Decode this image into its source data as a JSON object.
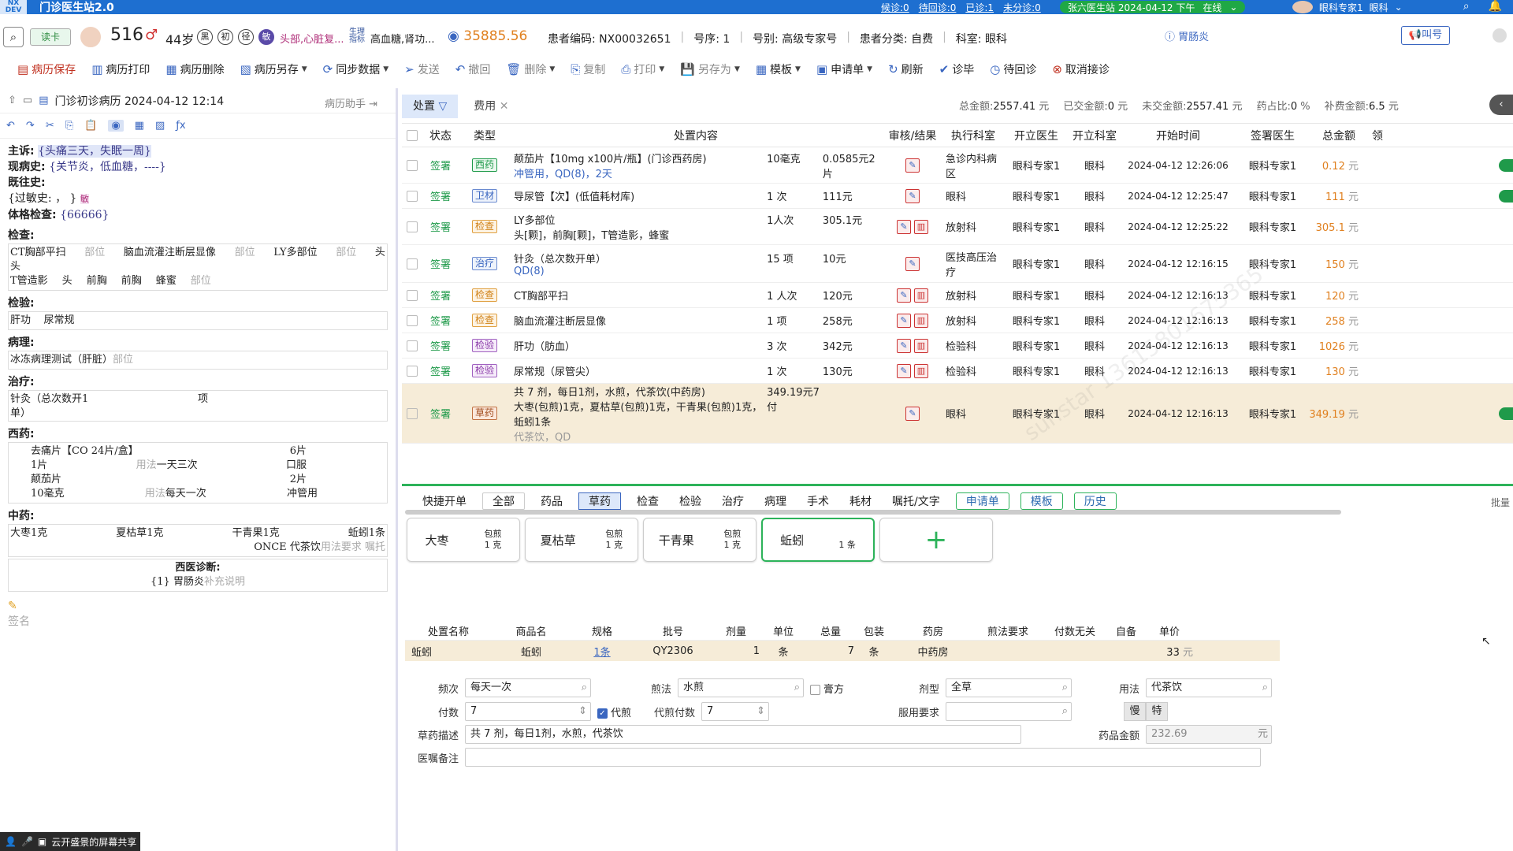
{
  "titlebar": {
    "logo": "NX DEV",
    "title": "门诊医生站2.0",
    "links": [
      "候诊:0",
      "待回诊:0",
      "已诊:1",
      "未分诊:0"
    ],
    "station": "张六医生站 2024-04-12 下午",
    "status": "在线",
    "user": "眼科专家1",
    "dept": "眼科"
  },
  "patient": {
    "read_btn": "读卡",
    "number": "516",
    "sex": "♂",
    "age": "44岁",
    "circles": [
      "黑",
      "初",
      "径",
      "敏"
    ],
    "allergy": "头部,心脏复...",
    "biomarker": "生理指标",
    "diagnosis_text": "高血糖,肾功...",
    "balance": "35885.56",
    "code_label": "患者编码:",
    "code": "NX00032651",
    "seq_label": "号序:",
    "seq": "1",
    "reg_label": "号别:",
    "reg": "高级专家号",
    "cat_label": "患者分类:",
    "cat": "自费",
    "dept_label": "科室:",
    "dept": "眼科",
    "diag_badge": "胃肠炎",
    "call_btn": "叫号"
  },
  "toolbar": [
    "病历保存",
    "病历打印",
    "病历删除",
    "病历另存",
    "同步数据",
    "发送",
    "撤回",
    "删除",
    "复制",
    "打印",
    "另存为",
    "模板",
    "申请单",
    "刷新",
    "诊毕",
    "待回诊",
    "取消接诊"
  ],
  "left": {
    "doc_title": "门诊初诊病历 2024-04-12 12:14",
    "assist": "病历助手",
    "cc_label": "主诉:",
    "cc": "{头痛三天，失眠一周}",
    "hpi_label": "现病史:",
    "hpi": "{关节炎，低血糖，----}",
    "ph_label": "既往史:",
    "allergy_label": "{过敏史:",
    "allergy_val": "， }",
    "pe_label": "体格检查:",
    "pe": "{66666}",
    "exam_label": "检查:",
    "exam_items": [
      "CT胸部平扫",
      "部位",
      "脑血流灌注断层显像",
      "部位",
      "LY多部位",
      "部位",
      "头"
    ],
    "exam_line2": [
      "头",
      "T管造影",
      "头",
      "前胸",
      "前胸",
      "蜂蜜",
      "部位"
    ],
    "lab_label": "检验:",
    "lab_items": [
      "肝功",
      "尿常规"
    ],
    "path_label": "病理:",
    "path": "冰冻病理测试（肝脏）",
    "path_part": "部位",
    "treat_label": "治疗:",
    "treat": "针灸（总次数开1",
    "treat_unit": "项",
    "treat_unit2": "单）",
    "wm_label": "西药:",
    "wm": [
      {
        "name": "去痛片【CO 24片/盒】",
        "qty": "6片"
      },
      {
        "name": "1片",
        "usage": "用法",
        "freq": "一天三次",
        "route": "口服"
      },
      {
        "name": "颠茄片",
        "qty": "2片"
      },
      {
        "name": "10毫克",
        "usage": "用法",
        "freq": "每天一次",
        "route": "冲管用"
      }
    ],
    "cm_label": "中药:",
    "cm_items": [
      "大枣1克",
      "夏枯草1克",
      "干青果1克",
      "蚯蚓1条"
    ],
    "cm_once": "ONCE",
    "cm_method": "代茶饮",
    "cm_req": "用法要求",
    "cm_note": "嘱托",
    "wd_label": "西医诊断:",
    "wd": "{1} 胃肠炎",
    "wd_hint": "补充说明",
    "sign": "签名"
  },
  "main": {
    "tab_active": "处置",
    "tab2": "费用",
    "summary": [
      {
        "label": "总金额:",
        "value": "2557.41",
        "unit": "元"
      },
      {
        "label": "已交金额:",
        "value": "0",
        "unit": "元"
      },
      {
        "label": "未交金额:",
        "value": "2557.41",
        "unit": "元"
      },
      {
        "label": "药占比:",
        "value": "0",
        "unit": "%"
      },
      {
        "label": "补费金额:",
        "value": "6.5",
        "unit": "元"
      }
    ],
    "headers": [
      "状态",
      "类型",
      "处置内容",
      "审核/结果",
      "执行科室",
      "开立医生",
      "开立科室",
      "开始时间",
      "签署医生",
      "总金额",
      "领"
    ],
    "rows": [
      {
        "status": "签署",
        "type": "西药",
        "tcls": "tb-xy",
        "name": "颠茄片【10mg x100片/瓶】(门诊西药房)",
        "sub": "冲管用，QD(8)，2天",
        "qty": "10毫克",
        "price": "0.0585元2片",
        "audit": 1,
        "exec": "急诊内科病区",
        "doc": "眼科专家1",
        "dept": "眼科",
        "time": "2024-04-12 12:26:06",
        "signer": "眼科专家1",
        "amount": "0.12",
        "tail": "台"
      },
      {
        "status": "签署",
        "type": "卫材",
        "tcls": "tb-wc",
        "name": "导尿管【次】(低值耗材库)",
        "sub": "",
        "qty": "1 次",
        "price": "111元",
        "audit": 1,
        "exec": "眼科",
        "doc": "眼科专家1",
        "dept": "眼科",
        "time": "2024-04-12 12:25:47",
        "signer": "眼科专家1",
        "amount": "111",
        "tail": "台"
      },
      {
        "status": "签署",
        "type": "检查",
        "tcls": "tb-jc",
        "name": "LY多部位",
        "sub": "头[颗]，前胸[颗]，T管造影，蜂蜜",
        "qty": "1人次",
        "price": "305.1元",
        "audit": 2,
        "exec": "放射科",
        "doc": "眼科专家1",
        "dept": "眼科",
        "time": "2024-04-12 12:25:22",
        "signer": "眼科专家1",
        "amount": "305.1",
        "tail": ""
      },
      {
        "status": "签署",
        "type": "治疗",
        "tcls": "tb-zl",
        "name": "针灸（总次数开单）",
        "sub": "QD(8)",
        "qty": "15 项",
        "price": "10元",
        "audit": 1,
        "exec": "医技高压治疗",
        "doc": "眼科专家1",
        "dept": "眼科",
        "time": "2024-04-12 12:16:15",
        "signer": "眼科专家1",
        "amount": "150",
        "tail": ""
      },
      {
        "status": "签署",
        "type": "检查",
        "tcls": "tb-jc",
        "name": "CT胸部平扫",
        "sub": "",
        "qty": "1 人次",
        "price": "120元",
        "audit": 2,
        "exec": "放射科",
        "doc": "眼科专家1",
        "dept": "眼科",
        "time": "2024-04-12 12:16:13",
        "signer": "眼科专家1",
        "amount": "120",
        "tail": ""
      },
      {
        "status": "签署",
        "type": "检查",
        "tcls": "tb-jc",
        "name": "脑血流灌注断层显像",
        "sub": "",
        "qty": "1 项",
        "price": "258元",
        "audit": 2,
        "exec": "放射科",
        "doc": "眼科专家1",
        "dept": "眼科",
        "time": "2024-04-12 12:16:13",
        "signer": "眼科专家1",
        "amount": "258",
        "tail": ""
      },
      {
        "status": "签署",
        "type": "检验",
        "tcls": "tb-jy",
        "name": "肝功（肪血）",
        "sub": "",
        "qty": "3 次",
        "price": "342元",
        "audit": 2,
        "exec": "检验科",
        "doc": "眼科专家1",
        "dept": "眼科",
        "time": "2024-04-12 12:16:13",
        "signer": "眼科专家1",
        "amount": "1026",
        "tail": ""
      },
      {
        "status": "签署",
        "type": "检验",
        "tcls": "tb-jy",
        "name": "尿常规（尿管尖）",
        "sub": "",
        "qty": "1 次",
        "price": "130元",
        "audit": 2,
        "exec": "检验科",
        "doc": "眼科专家1",
        "dept": "眼科",
        "time": "2024-04-12 12:16:13",
        "signer": "眼科专家1",
        "amount": "130",
        "tail": ""
      },
      {
        "status": "签署",
        "type": "草药",
        "tcls": "tb-cy",
        "name": "共 7 剂，每日1剂，水煎，代茶饮(中药房)",
        "sub": "大枣(包煎)1克，夏枯草(包煎)1克，干青果(包煎)1克，蚯蚓1条",
        "sub2": "代茶饮，QD",
        "qty": "349.19元7付",
        "price": "",
        "audit": 1,
        "exec": "眼科",
        "doc": "眼科专家1",
        "dept": "眼科",
        "time": "2024-04-12 12:16:13",
        "signer": "眼科专家1",
        "amount": "349.19",
        "tail": "台"
      }
    ]
  },
  "bottom": {
    "tabs": [
      "快捷开单",
      "全部",
      "药品",
      "草药",
      "检查",
      "检验",
      "治疗",
      "病理",
      "手术",
      "耗材",
      "嘱托/文字"
    ],
    "green_tabs": [
      "申请单",
      "模板",
      "历史"
    ],
    "batch": "批量",
    "herbs": [
      {
        "name": "大枣",
        "prep": "包煎",
        "dose": "1 克"
      },
      {
        "name": "夏枯草",
        "prep": "包煎",
        "dose": "1 克"
      },
      {
        "name": "干青果",
        "prep": "包煎",
        "dose": "1 克"
      },
      {
        "name": "蚯蚓",
        "prep": "",
        "dose": "1 条"
      }
    ],
    "dheaders": [
      "处置名称",
      "商品名",
      "规格",
      "批号",
      "剂量",
      "单位",
      "总量",
      "包装",
      "药房",
      "煎法要求",
      "付数无关",
      "自备",
      "单价"
    ],
    "drow": {
      "name": "蚯蚓",
      "product": "蚯蚓",
      "spec": "1条",
      "batch": "QY2306",
      "dose": "1",
      "unit": "条",
      "total": "7",
      "pack": "条",
      "pharmacy": "中药房",
      "price": "33"
    },
    "form": {
      "freq_label": "频次",
      "freq": "每天一次",
      "decoct_label": "煎法",
      "decoct": "水煎",
      "paste_label": "膏方",
      "form_label": "剂型",
      "form": "全草",
      "usage_label": "用法",
      "usage": "代茶饮",
      "fu_label": "付数",
      "fu": "7",
      "daijian_label": "代煎",
      "daijianfu_label": "代煎付数",
      "daijianfu": "7",
      "req_label": "服用要求",
      "req": "",
      "slow": "慢",
      "special": "特",
      "desc_label": "草药描述",
      "desc": "共 7 剂，每日1剂，水煎，代茶饮",
      "amount_label": "药品金额",
      "amount": "232.69",
      "amount_unit": "元",
      "note_label": "医嘱备注",
      "note": ""
    }
  },
  "share": "云开盛景的屏幕共享"
}
